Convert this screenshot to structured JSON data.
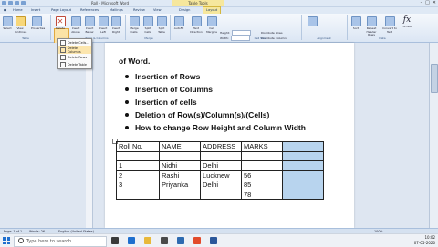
{
  "window": {
    "title": "Roll - Microsoft Word",
    "context_tab": "Table Tools"
  },
  "tabs": [
    "Home",
    "Insert",
    "Page Layout",
    "References",
    "Mailings",
    "Review",
    "View",
    "Design",
    "Layout"
  ],
  "ribbon": {
    "buttons": [
      "Select",
      "View Gridlines",
      "Properties",
      "Delete",
      "Insert Above",
      "Insert Below",
      "Insert Left",
      "Insert Right",
      "Merge Cells",
      "Split Cells",
      "Split Table",
      "AutoFit",
      "Text Direction",
      "Cell Margins",
      "Sort",
      "Repeat Header Rows",
      "Convert to Text",
      "Formula"
    ],
    "groups": [
      "Table",
      "Rows & Columns",
      "Merge",
      "Cell Size",
      "Alignment",
      "Data"
    ],
    "height_label": "Height:",
    "width_label": "Width:",
    "height_value": "",
    "width_value": "",
    "distribute_rows": "Distribute Rows",
    "distribute_columns": "Distribute Columns"
  },
  "delete_menu": [
    "Delete Cells...",
    "Delete Columns",
    "Delete Rows",
    "Delete Table"
  ],
  "document": {
    "heading": "of Word.",
    "bullets": [
      "Insertion of Rows",
      "Insertion of Columns",
      "Insertion of cells",
      "Deletion of Row(s)/Column(s)/(Cells)",
      "How to change Row Height and Column Width"
    ],
    "table": {
      "headers": [
        "Roll No.",
        "NAME",
        "ADDRESS",
        "MARKS",
        ""
      ],
      "rows": [
        [
          "",
          "",
          "",
          "",
          ""
        ],
        [
          "1",
          "Nidhi",
          "Delhi",
          "",
          ""
        ],
        [
          "2",
          "Rashi",
          "Lucknew",
          "56",
          ""
        ],
        [
          "3",
          "Priyanka",
          "Delhi",
          "85",
          ""
        ],
        [
          "",
          "",
          "",
          "78",
          ""
        ]
      ]
    }
  },
  "status": {
    "page": "Page: 1 of 1",
    "words": "Words: 26",
    "language": "English (United States)",
    "zoom": "100%"
  },
  "taskbar": {
    "search_placeholder": "Type here to search",
    "time": "10:02",
    "date": "07-05-2020"
  },
  "colors": {
    "ribbon": "#dbe6f4",
    "selected_cells": "#b8d4ee",
    "highlight": "#fce6ae"
  },
  "icons": [
    "windows-start-icon",
    "search-icon",
    "delete-icon",
    "formula-icon"
  ]
}
